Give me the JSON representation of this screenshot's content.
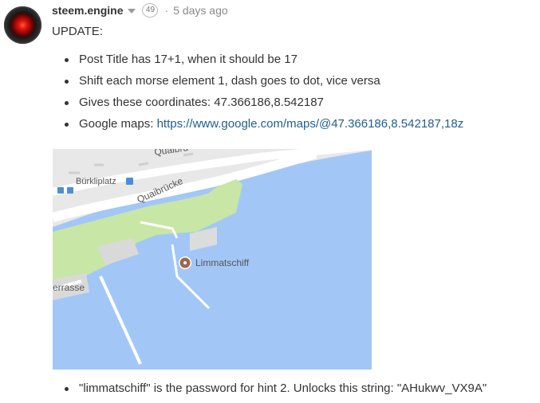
{
  "comment": {
    "author": "steem.engine",
    "reputation": "49",
    "separator": "·",
    "time": "5 days ago",
    "heading": "UPDATE:",
    "bullets": [
      {
        "text": "Post Title has 17+1, when it should be 17"
      },
      {
        "text": "Shift each morse element 1, dash goes to dot, vice versa"
      },
      {
        "text": "Gives these coordinates: 47.366186,8.542187"
      },
      {
        "prefix": "Google maps: ",
        "link": "https://www.google.com/maps/@47.366186,8.542187,18z"
      }
    ],
    "map": {
      "labels": {
        "bridge_top": "Quaibrü",
        "square": "Bürkliplatz",
        "bridge": "Quaibrücke",
        "place": "Limmatschiff",
        "terrace": "errasse"
      },
      "colors": {
        "water": "#a2c7f7",
        "park": "#c8e6a5",
        "road": "#ffffff",
        "pin": "#a0674b"
      }
    },
    "footer_bullet": "\"limmatschiff\" is the password for hint 2. Unlocks this string: \"AHukwv_VX9A\""
  }
}
